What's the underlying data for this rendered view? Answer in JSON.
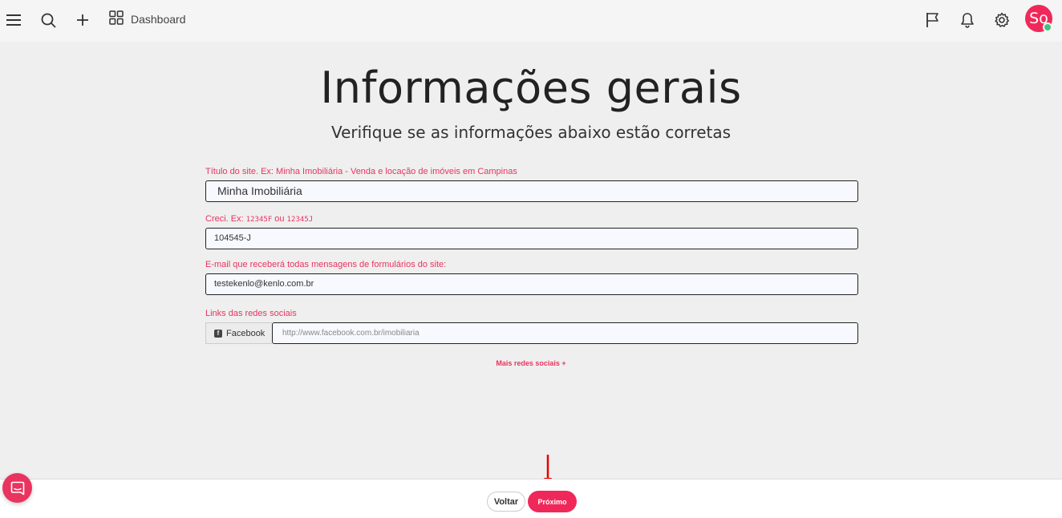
{
  "topbar": {
    "menu_icon": "hamburger-icon",
    "search_icon": "search-icon",
    "add_icon": "plus-icon",
    "dashboard_icon": "grid-icon",
    "dashboard_label": "Dashboard",
    "flag_icon": "flag-icon",
    "bell_icon": "bell-icon",
    "settings_icon": "gear-icon",
    "avatar_initials": "So",
    "avatar_color": "#f0285a",
    "status_color": "#3fc47f"
  },
  "main": {
    "title": "Informações gerais",
    "subtitle": "Verifique se as informações abaixo estão corretas"
  },
  "form": {
    "site_title": {
      "label": "Título do site. Ex: Minha Imobiliária - Venda e locação de imóveis em Campinas",
      "value": "Minha Imobiliária"
    },
    "creci": {
      "label_prefix": "Creci. Ex: ",
      "example1": "12345F",
      "label_mid": " ou ",
      "example2": "12345J",
      "value": "104545-J"
    },
    "email": {
      "label": "E-mail que receberá todas mensagens de formulários do site:",
      "value": "testekenlo@kenlo.com.br"
    },
    "social": {
      "label": "Links das redes sociais",
      "network": "Facebook",
      "placeholder": "http://www.facebook.com.br/imobiliaria"
    },
    "more_social": "Mais redes sociais +"
  },
  "footer": {
    "back_label": "Voltar",
    "next_label": "Próximo"
  },
  "colors": {
    "accent": "#f0285a",
    "label": "#e8345f"
  }
}
